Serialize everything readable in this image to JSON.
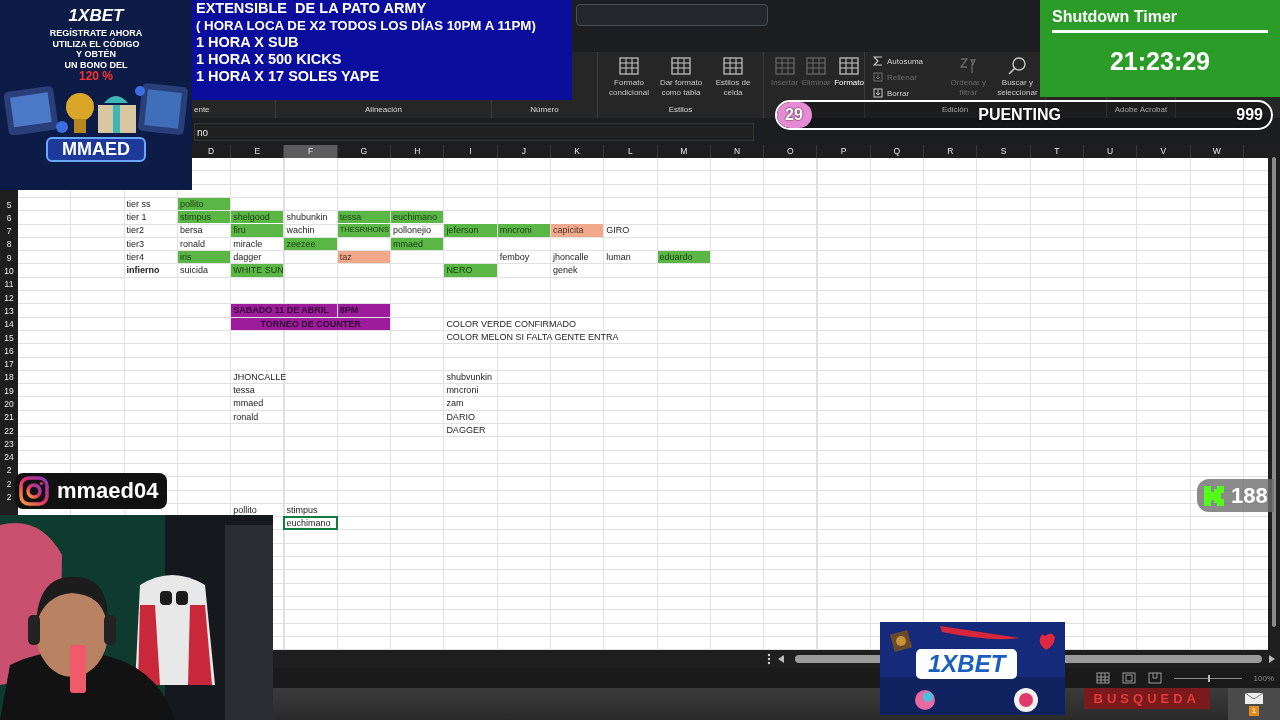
{
  "ad_top": {
    "brand": "1XBET",
    "lines": [
      "REGÍSTRATE AHORA",
      "UTILIZA EL CÓDIGO",
      "Y OBTÉN",
      "UN BONO DEL"
    ],
    "bonus": "120 %",
    "code": "MMAED"
  },
  "promo_banner": {
    "lines": [
      "EXTENSIBLE  DE LA PATO ARMY",
      "( HORA LOCA DE X2 TODOS LOS DÍAS 10PM A 11PM)",
      "1 HORA X SUB",
      "1 HORA X 500 KICKS",
      "1 HORA X 17 SOLES YAPE"
    ]
  },
  "ribbon": {
    "groups": [
      {
        "label": "ente"
      },
      {
        "label": "Alineación"
      },
      {
        "label": "Número"
      },
      {
        "label": "Estilos",
        "commands": [
          {
            "kind": "large",
            "label": "Formato condicional",
            "disabled": false
          },
          {
            "kind": "large",
            "label": "Dar formato como tabla",
            "disabled": false
          },
          {
            "kind": "large",
            "label": "Estilos de celda",
            "disabled": false
          }
        ]
      },
      {
        "commands": [
          {
            "kind": "large",
            "label": "Insertar",
            "disabled": true
          },
          {
            "kind": "large",
            "label": "Eliminar",
            "disabled": true
          },
          {
            "kind": "large",
            "label": "Formato",
            "disabled": false
          }
        ]
      },
      {
        "label": "Edición",
        "commands": [
          {
            "kind": "sum",
            "label": "Autosuma",
            "disabled": false
          },
          {
            "kind": "small",
            "label": "Rellenar",
            "disabled": true
          },
          {
            "kind": "small",
            "label": "Borrar",
            "disabled": false
          },
          {
            "kind": "sort",
            "label": "Ordenar y filtrar",
            "disabled": true
          },
          {
            "kind": "find",
            "label": "Buscar y seleccionar",
            "disabled": false
          }
        ]
      },
      {
        "label": "Adobe Acrobat"
      }
    ]
  },
  "formula_bar": {
    "value": "no"
  },
  "sheet": {
    "columns": [
      {
        "label": "D",
        "selected": false
      },
      {
        "label": "E",
        "selected": false
      },
      {
        "label": "F",
        "selected": true
      },
      {
        "label": "G",
        "selected": false
      },
      {
        "label": "H",
        "selected": false
      },
      {
        "label": "I",
        "selected": false
      },
      {
        "label": "J",
        "selected": false
      },
      {
        "label": "K",
        "selected": false
      },
      {
        "label": "L",
        "selected": false
      },
      {
        "label": "M",
        "selected": false
      },
      {
        "label": "N",
        "selected": false
      },
      {
        "label": "O",
        "selected": false
      },
      {
        "label": "P",
        "selected": false
      },
      {
        "label": "Q",
        "selected": false
      },
      {
        "label": "R",
        "selected": false
      },
      {
        "label": "S",
        "selected": false
      },
      {
        "label": "T",
        "selected": false
      },
      {
        "label": "U",
        "selected": false
      },
      {
        "label": "V",
        "selected": false
      },
      {
        "label": "W",
        "selected": false
      }
    ],
    "rows": [
      {},
      {
        "number": "5",
        "cells": [
          null,
          null,
          {
            "text": "tier ss"
          },
          {
            "text": "pollito",
            "color": "#5ab745"
          }
        ]
      },
      {
        "number": "6",
        "cells": [
          null,
          null,
          {
            "text": "tier 1"
          },
          {
            "text": "stimpus",
            "color": "#5ab745"
          },
          {
            "text": "shelgood",
            "color": "#5ab745"
          },
          {
            "text": "shubunkin"
          },
          {
            "text": "tessa",
            "color": "#5ab745"
          },
          {
            "text": "euchimano",
            "color": "#5ab745"
          }
        ]
      },
      {
        "number": "7",
        "cells": [
          null,
          null,
          {
            "text": "tier2"
          },
          {
            "text": "bersa"
          },
          {
            "text": "firu",
            "color": "#5ab745"
          },
          {
            "text": "wachin"
          },
          {
            "text": "THESRIHONS",
            "color": "#5ab745",
            "small": true
          },
          {
            "text": "pollonejio"
          },
          {
            "text": "jeferson",
            "color": "#5ab745"
          },
          {
            "text": "mncroni",
            "color": "#5ab745"
          },
          {
            "text": "capicita",
            "color": "#f2a98b"
          },
          {
            "text": "GIRO"
          }
        ]
      },
      {
        "number": "8",
        "cells": [
          null,
          null,
          {
            "text": "tier3"
          },
          {
            "text": "ronald"
          },
          {
            "text": "miracle"
          },
          {
            "text": "zeezee",
            "color": "#5ab745"
          },
          null,
          {
            "text": "mmaed",
            "color": "#5ab745"
          }
        ]
      },
      {
        "number": "9",
        "cells": [
          null,
          null,
          {
            "text": "tier4"
          },
          {
            "text": "iris",
            "color": "#5ab745"
          },
          {
            "text": "dagger"
          },
          null,
          {
            "text": "taz",
            "color": "#f2a98b"
          },
          null,
          null,
          {
            "text": "femboy"
          },
          {
            "text": "jhoncalle"
          },
          {
            "text": "luman"
          },
          {
            "text": "eduardo",
            "color": "#5ab745"
          }
        ]
      },
      {
        "number": "10",
        "cells": [
          null,
          null,
          {
            "text": "infierno",
            "bold": true
          },
          {
            "text": "suicida"
          },
          {
            "text": "WHITE SUN",
            "color": "#5ab745"
          },
          null,
          null,
          null,
          {
            "text": "NERO",
            "color": "#5ab745"
          },
          null,
          {
            "text": "genek"
          }
        ]
      },
      {
        "number": "11"
      },
      {
        "number": "12"
      },
      {
        "number": "13",
        "cells": [
          null,
          null,
          null,
          null,
          {
            "text": "SABADO 11 DE ABRIL",
            "color": "#9c1c9c",
            "bold": true
          },
          {
            "covered": true
          },
          {
            "text": "8PM",
            "color": "#9c1c9c",
            "bold": true
          }
        ]
      },
      {
        "number": "14",
        "cells": [
          null,
          null,
          null,
          null,
          {
            "text": "TORNEO DE COUNTER",
            "color": "#9c1c9c",
            "bold": true,
            "centered": true
          },
          {
            "covered": true
          },
          {
            "covered": true
          },
          null,
          {
            "text": "COLOR VERDE CONFIRMADO"
          }
        ]
      },
      {
        "number": "15",
        "cells": [
          null,
          null,
          null,
          null,
          null,
          null,
          null,
          null,
          {
            "text": "COLOR MELON SI FALTA GENTE ENTRA"
          }
        ]
      },
      {
        "number": "16"
      },
      {
        "number": "17"
      },
      {
        "number": "18",
        "cells": [
          null,
          null,
          null,
          null,
          {
            "text": "JHONCALLE"
          },
          null,
          null,
          null,
          {
            "text": "shubvunkin"
          }
        ]
      },
      {
        "number": "19",
        "cells": [
          null,
          null,
          null,
          null,
          {
            "text": "tessa"
          },
          null,
          null,
          null,
          {
            "text": "mncroni"
          }
        ]
      },
      {
        "number": "20",
        "cells": [
          null,
          null,
          null,
          null,
          {
            "text": "mmaed"
          },
          null,
          null,
          null,
          {
            "text": "zam"
          }
        ]
      },
      {
        "number": "21",
        "cells": [
          null,
          null,
          null,
          null,
          {
            "text": "ronald"
          },
          null,
          null,
          null,
          {
            "text": "DARIO"
          }
        ]
      },
      {
        "number": "22",
        "cells": [
          null,
          null,
          null,
          null,
          null,
          null,
          null,
          null,
          {
            "text": "DAGGER"
          }
        ]
      },
      {
        "number": "23"
      },
      {
        "number": "24"
      },
      {
        "number": "2"
      },
      {
        "number": "2"
      },
      {
        "number": "2"
      },
      {
        "cells": [
          null,
          null,
          null,
          null,
          {
            "text": "pollito"
          },
          {
            "text": "stimpus"
          }
        ]
      },
      {
        "cells": [
          null,
          null,
          null,
          null,
          null,
          {
            "text": "euchimano",
            "selected": true
          }
        ]
      }
    ]
  },
  "status_bar": {
    "zoom": "100%",
    "zoom_slider": {
      "level": 0.5
    }
  },
  "taskbar": {
    "search_text": "BUSQUEDA",
    "mail_badge": "1"
  },
  "timer": {
    "title": "Shutdown Timer",
    "time": "21:23:29"
  },
  "goal_bar": {
    "current": "29",
    "title": "PUENTING",
    "target": "999",
    "level": 0.07
  },
  "instagram": {
    "handle": "mmaed04"
  },
  "kick": {
    "count": "188"
  },
  "ad_bottom": {
    "brand": "1XBET"
  }
}
